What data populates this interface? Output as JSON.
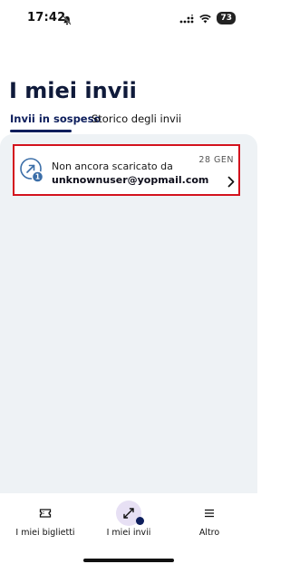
{
  "status_bar": {
    "time": "17:42",
    "battery": "73"
  },
  "header": {
    "title": "I miei invii",
    "tabs": [
      {
        "label": "Invii in sospeso",
        "active": true
      },
      {
        "label": "Storico degli invii",
        "active": false
      }
    ]
  },
  "list": {
    "items": [
      {
        "title": "Non ancora scaricato da",
        "recipient": "unknownuser@yopmail.com",
        "date": "28 GEN",
        "badge": "1",
        "icon": "arrow-up-right-icon"
      }
    ]
  },
  "bottom_nav": {
    "items": [
      {
        "label": "I miei biglietti",
        "icon": "ticket-icon"
      },
      {
        "label": "I miei invii",
        "icon": "transfer-icon",
        "active": true
      },
      {
        "label": "Altro",
        "icon": "menu-icon"
      }
    ]
  },
  "colors": {
    "navy": "#0d1e5c",
    "background": "#eef2f5",
    "highlight_border": "#d3131e",
    "badge": "#3b6ea8",
    "active_nav_bg": "#e7e0f4"
  }
}
